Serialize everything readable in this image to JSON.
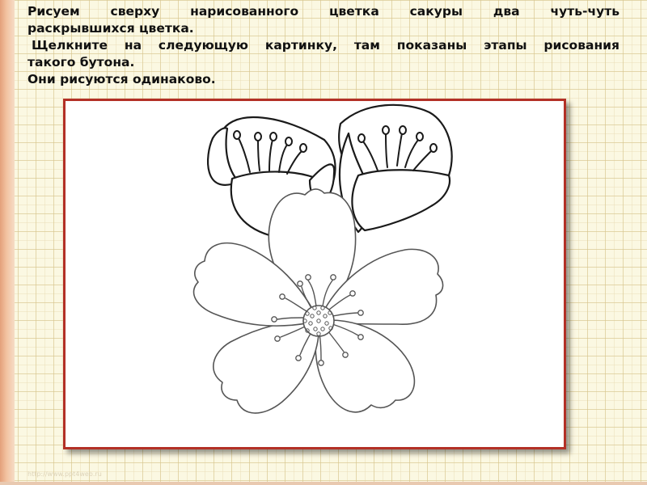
{
  "instructions": {
    "line1": "Рисуем сверху нарисованного цветка сакуры два чуть-чуть",
    "line2": "раскрывшихся цветка.",
    "line3": " Щелкните на следующую картинку, там показаны этапы рисования",
    "line4": "такого бутона.",
    "line5": "Они рисуются одинаково."
  },
  "watermark": "http://www.ppt4web.ru",
  "colors": {
    "frame_border": "#b33026",
    "outline": "#1a1a1a",
    "flower_line": "#555555"
  }
}
